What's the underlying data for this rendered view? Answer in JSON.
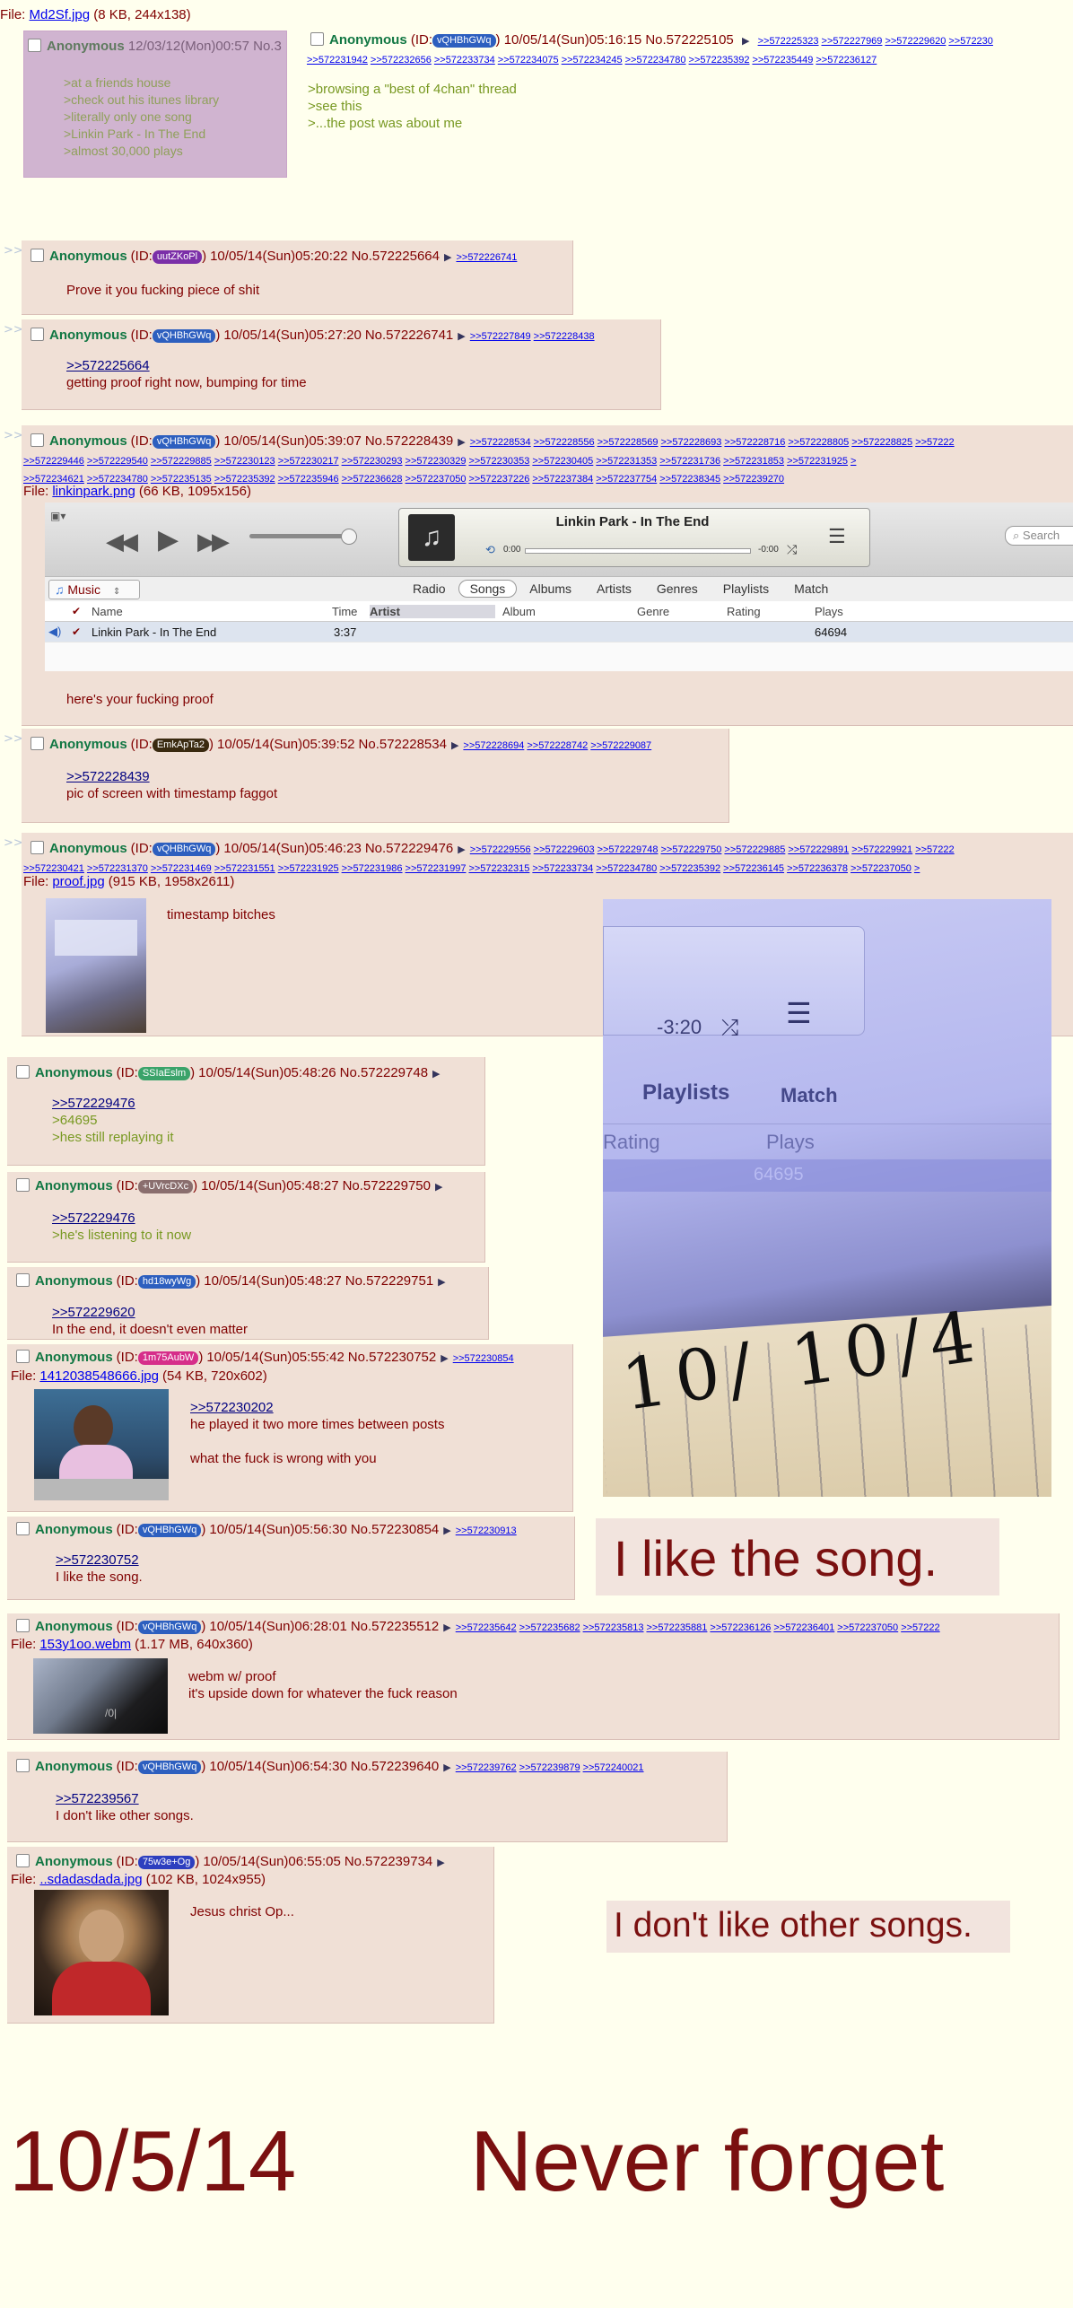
{
  "op": {
    "file_label": "File:",
    "file_name": "Md2Sf.jpg",
    "file_meta": "(8 KB, 244x138)",
    "inner_post": {
      "name": "Anonymous",
      "datetime": "12/03/12(Mon)00:57 No.3",
      "lines": [
        ">at a friends house",
        ">check out his itunes library",
        ">literally only one song",
        ">Linkin Park - In The End",
        ">almost 30,000 plays"
      ]
    },
    "name": "Anonymous",
    "id_prefix": "(ID:",
    "id": "vQHBhGWq",
    "id_suffix": ")",
    "datetime": "10/05/14(Sun)05:16:15",
    "number": "No.572225105",
    "backlinks_row1": [
      ">>572225323",
      ">>572227969",
      ">>572229620",
      ">>572230"
    ],
    "backlinks_row2": [
      ">>572231942",
      ">>572232656",
      ">>572233734",
      ">>572234075",
      ">>572234245",
      ">>572234780",
      ">>572235392",
      ">>572235449",
      ">>572236127"
    ],
    "lines": [
      ">browsing a \"best of 4chan\" thread",
      ">see this",
      ">...the post was about me"
    ]
  },
  "posts": [
    {
      "key": "p1",
      "name": "Anonymous",
      "id": "uutZKoPl",
      "id_color": "#7b2fa8",
      "datetime": "10/05/14(Sun)05:20:22",
      "number": "No.572225664",
      "backlinks": [
        ">>572226741"
      ],
      "lines": [
        {
          "t": "Prove it you fucking piece of shit",
          "k": "text"
        }
      ]
    },
    {
      "key": "p2",
      "name": "Anonymous",
      "id": "vQHBhGWq",
      "id_color": "#2d5fbf",
      "datetime": "10/05/14(Sun)05:27:20",
      "number": "No.572226741",
      "backlinks": [
        ">>572227849",
        ">>572228438"
      ],
      "lines": [
        {
          "t": ">>572225664",
          "k": "link"
        },
        {
          "t": "getting proof right now, bumping for time",
          "k": "text"
        }
      ]
    },
    {
      "key": "p3",
      "name": "Anonymous",
      "id": "vQHBhGWq",
      "id_color": "#2d5fbf",
      "datetime": "10/05/14(Sun)05:39:07",
      "number": "No.572228439",
      "backlinks": [
        ">>572228534",
        ">>572228556",
        ">>572228569",
        ">>572228693",
        ">>572228716",
        ">>572228805",
        ">>572228825",
        ">>57222"
      ],
      "backlinks2": [
        ">>572229446",
        ">>572229540",
        ">>572229885",
        ">>572230123",
        ">>572230217",
        ">>572230293",
        ">>572230329",
        ">>572230353",
        ">>572230405",
        ">>572231353",
        ">>572231736",
        ">>572231853",
        ">>572231925",
        ">"
      ],
      "backlinks3": [
        ">>572234621",
        ">>572234780",
        ">>572235135",
        ">>572235392",
        ">>572235946",
        ">>572236628",
        ">>572237050",
        ">>572237226",
        ">>572237384",
        ">>572237754",
        ">>572238345",
        ">>572239270"
      ],
      "file_name": "linkinpark.png",
      "file_meta": "(66 KB, 1095x156)",
      "lines": [
        {
          "t": "here's your fucking proof",
          "k": "text"
        }
      ]
    },
    {
      "key": "p4",
      "name": "Anonymous",
      "id": "EmkApTa2",
      "id_color": "#3a2a10",
      "datetime": "10/05/14(Sun)05:39:52",
      "number": "No.572228534",
      "backlinks": [
        ">>572228694",
        ">>572228742",
        ">>572229087"
      ],
      "lines": [
        {
          "t": ">>572228439",
          "k": "link"
        },
        {
          "t": "pic of screen with timestamp faggot",
          "k": "text"
        }
      ]
    },
    {
      "key": "p5",
      "name": "Anonymous",
      "id": "vQHBhGWq",
      "id_color": "#2d5fbf",
      "datetime": "10/05/14(Sun)05:46:23",
      "number": "No.572229476",
      "backlinks": [
        ">>572229556",
        ">>572229603",
        ">>572229748",
        ">>572229750",
        ">>572229885",
        ">>572229891",
        ">>572229921",
        ">>57222"
      ],
      "backlinks2": [
        ">>572230421",
        ">>572231370",
        ">>572231469",
        ">>572231551",
        ">>572231925",
        ">>572231986",
        ">>572231997",
        ">>572232315",
        ">>572233734",
        ">>572234780",
        ">>572235392",
        ">>572236145",
        ">>572236378",
        ">>572237050",
        ">"
      ],
      "file_name": "proof.jpg",
      "file_meta": "(915 KB, 1958x2611)",
      "lines": [
        {
          "t": "timestamp bitches",
          "k": "text"
        }
      ]
    },
    {
      "key": "p6",
      "name": "Anonymous",
      "id": "SSIaEslm",
      "id_color": "#3aa36a",
      "datetime": "10/05/14(Sun)05:48:26",
      "number": "No.572229748",
      "backlinks": [],
      "lines": [
        {
          "t": ">>572229476",
          "k": "link"
        },
        {
          "t": ">64695",
          "k": "quote"
        },
        {
          "t": ">hes still replaying it",
          "k": "quote"
        }
      ]
    },
    {
      "key": "p7",
      "name": "Anonymous",
      "id": "+UVrcDXc",
      "id_color": "#8a6e6e",
      "datetime": "10/05/14(Sun)05:48:27",
      "number": "No.572229750",
      "backlinks": [],
      "lines": [
        {
          "t": ">>572229476",
          "k": "link"
        },
        {
          "t": ">he's listening to it now",
          "k": "quote"
        }
      ]
    },
    {
      "key": "p8",
      "name": "Anonymous",
      "id": "hd18wyWg",
      "id_color": "#2d5fbf",
      "datetime": "10/05/14(Sun)05:48:27",
      "number": "No.572229751",
      "backlinks": [],
      "lines": [
        {
          "t": ">>572229620",
          "k": "link"
        },
        {
          "t": "In the end, it doesn't even matter",
          "k": "text"
        }
      ]
    },
    {
      "key": "p9",
      "name": "Anonymous",
      "id": "1m75AubW",
      "id_color": "#d62e8a",
      "datetime": "10/05/14(Sun)05:55:42",
      "number": "No.572230752",
      "backlinks": [
        ">>572230854"
      ],
      "file_name": "1412038548666.jpg",
      "file_meta": "(54 KB, 720x602)",
      "lines": [
        {
          "t": ">>572230202",
          "k": "link"
        },
        {
          "t": "he played it two more times between posts",
          "k": "text"
        },
        {
          "t": "",
          "k": "text"
        },
        {
          "t": "what the fuck is wrong with you",
          "k": "text"
        }
      ]
    },
    {
      "key": "p10",
      "name": "Anonymous",
      "id": "vQHBhGWq",
      "id_color": "#2d5fbf",
      "datetime": "10/05/14(Sun)05:56:30",
      "number": "No.572230854",
      "backlinks": [
        ">>572230913"
      ],
      "lines": [
        {
          "t": ">>572230752",
          "k": "link"
        },
        {
          "t": "I like the song.",
          "k": "text"
        }
      ]
    },
    {
      "key": "p11",
      "name": "Anonymous",
      "id": "vQHBhGWq",
      "id_color": "#2d5fbf",
      "datetime": "10/05/14(Sun)06:28:01",
      "number": "No.572235512",
      "backlinks": [
        ">>572235642",
        ">>572235682",
        ">>572235813",
        ">>572235881",
        ">>572236126",
        ">>572236401",
        ">>572237050",
        ">>57222"
      ],
      "file_name": "153y1oo.webm",
      "file_meta": "(1.17 MB, 640x360)",
      "lines": [
        {
          "t": "webm w/ proof",
          "k": "text"
        },
        {
          "t": "it's upside down for whatever the fuck reason",
          "k": "text"
        }
      ]
    },
    {
      "key": "p12",
      "name": "Anonymous",
      "id": "vQHBhGWq",
      "id_color": "#2d5fbf",
      "datetime": "10/05/14(Sun)06:54:30",
      "number": "No.572239640",
      "backlinks": [
        ">>572239762",
        ">>572239879",
        ">>572240021"
      ],
      "lines": [
        {
          "t": ">>572239567",
          "k": "link"
        },
        {
          "t": "I don't like other songs.",
          "k": "text"
        }
      ]
    },
    {
      "key": "p13",
      "name": "Anonymous",
      "id": "75w3e+Og",
      "id_color": "#2d3fbf",
      "datetime": "10/05/14(Sun)06:55:05",
      "number": "No.572239734",
      "backlinks": [],
      "file_name": "..sdadasdada.jpg",
      "file_meta": "(102 KB, 1024x955)",
      "lines": [
        {
          "t": "Jesus christ Op...",
          "k": "text"
        }
      ]
    }
  ],
  "itunes": {
    "now_playing": "Linkin Park - In The End",
    "time_elapsed": "0:00",
    "time_remaining": "-0:00",
    "search_placeholder": "Search",
    "library_source": "Music",
    "tabs": [
      "Radio",
      "Songs",
      "Albums",
      "Artists",
      "Genres",
      "Playlists",
      "Match"
    ],
    "active_tab": "Songs",
    "columns": [
      "Name",
      "Time",
      "Artist",
      "Album",
      "Genre",
      "Rating",
      "Plays"
    ],
    "row": {
      "name": "Linkin Park - In The End",
      "time": "3:37",
      "plays": "64694"
    }
  },
  "proof_photo": {
    "time_remaining": "-3:20",
    "col_playlists": "Playlists",
    "col_match": "Match",
    "col_rating": "Rating",
    "col_plays": "Plays",
    "plays_value": "64695",
    "handwritten_date": "10/ 10/4"
  },
  "captions": {
    "like_song": "I like the song.",
    "dont_like": "I don't like other songs.",
    "date": "10/5/14",
    "never_forget": "Never forget"
  },
  "colors": {
    "background": "#ffffee",
    "post_bg": "#f0e0d6",
    "name": "#117743",
    "text": "#800000",
    "quote": "#789922",
    "caption_text": "#7a1010"
  }
}
